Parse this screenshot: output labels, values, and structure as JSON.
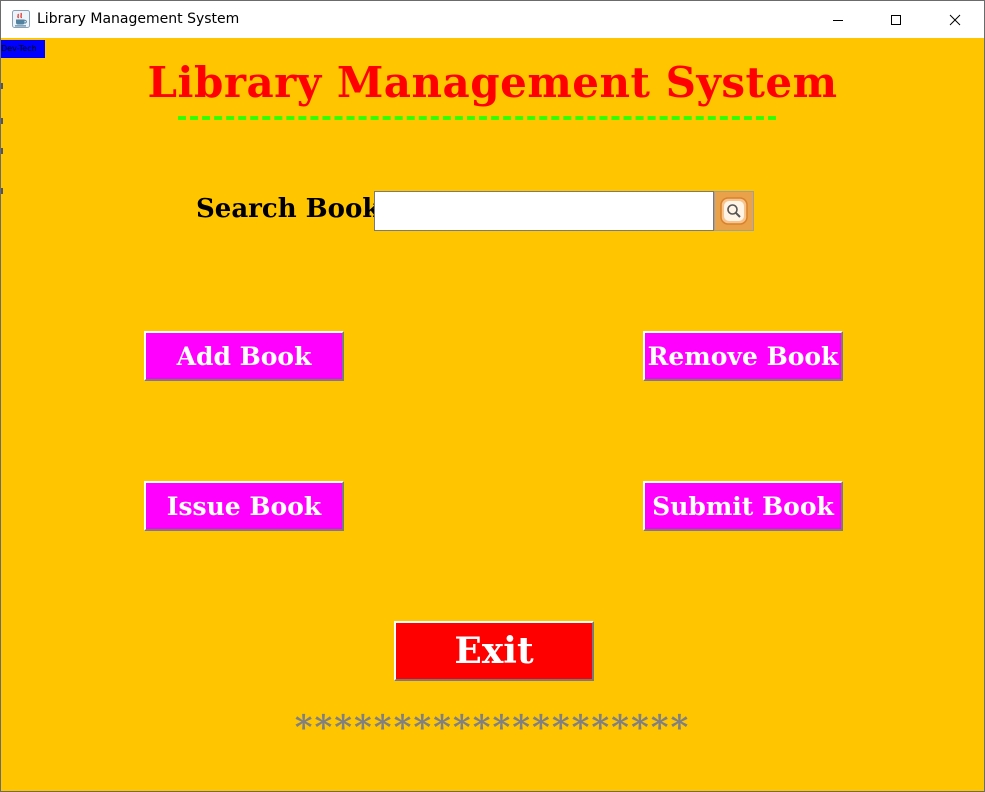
{
  "window": {
    "title": "Library Management System",
    "icons": {
      "app": "java-cup-icon",
      "minimize": "minimize-icon",
      "maximize": "maximize-icon",
      "close": "close-icon"
    }
  },
  "badge": {
    "text": "Dev-Tech"
  },
  "header": {
    "title": "Library Management System"
  },
  "search": {
    "label": "Search Book",
    "value": "",
    "placeholder": "",
    "button_icon": "search-icon"
  },
  "actions": {
    "add_book": "Add Book",
    "remove_book": "Remove Book",
    "issue_book": "Issue Book",
    "submit_book": "Submit Book"
  },
  "exit": {
    "label": "Exit"
  },
  "footer": {
    "stars": "********************"
  },
  "colors": {
    "background": "#FFC600",
    "title": "#FF0000",
    "underline": "#33FF00",
    "action_button": "#FF00FF",
    "exit_button": "#FF0000",
    "badge": "#0000FF",
    "stars": "#808080"
  }
}
